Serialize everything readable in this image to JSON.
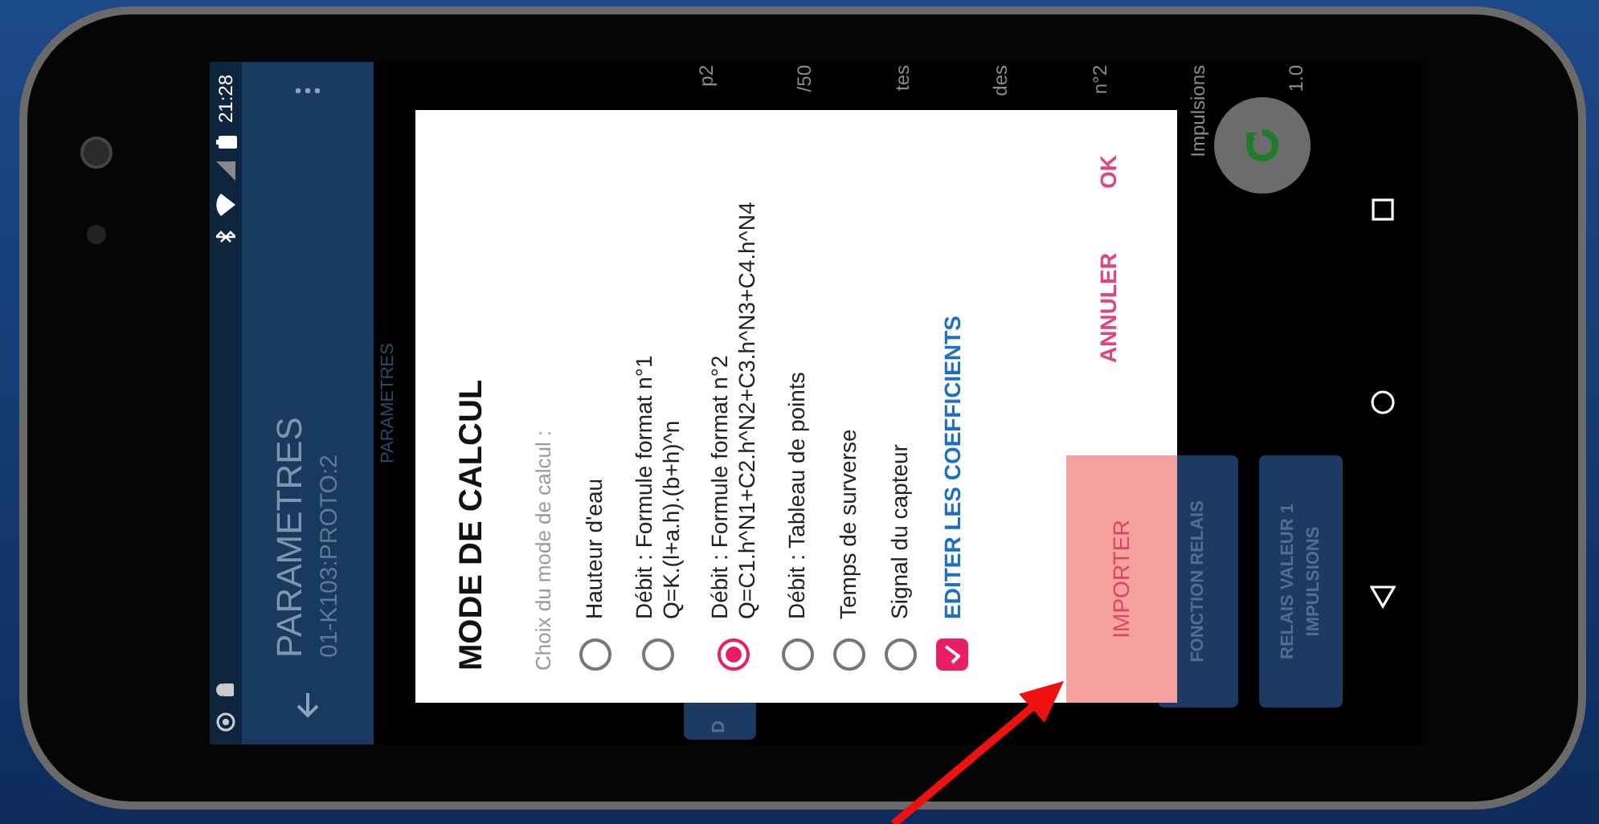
{
  "status_bar": {
    "time": "21:28"
  },
  "app_bar": {
    "title": "PARAMETRES",
    "subtitle": "01-K103:PROTO:2"
  },
  "section_label": "PARAMETRES",
  "background_labels": [
    "p2",
    "/50",
    "tes",
    "des",
    "n°2",
    "Impulsions",
    "1.0"
  ],
  "background_buttons": [
    "D",
    "FONCTION RELAIS",
    "RELAIS VALEUR 1 IMPULSIONS"
  ],
  "dialog": {
    "title": "MODE DE CALCUL",
    "subtitle": "Choix du mode de calcul :",
    "options": [
      {
        "label": "Hauteur d'eau",
        "selected": false
      },
      {
        "label": "Débit : Formule format n°1",
        "formula": "Q=K.(l+a.h).(b+h)^n",
        "selected": false
      },
      {
        "label": "Débit : Formule format n°2",
        "formula": "Q=C1.h^N1+C2.h^N2+C3.h^N3+C4.h^N4",
        "selected": true
      },
      {
        "label": "Débit : Tableau de points",
        "selected": false
      },
      {
        "label": "Temps de surverse",
        "selected": false
      },
      {
        "label": "Signal du capteur",
        "selected": false
      }
    ],
    "checkbox": {
      "label": "EDITER LES COEFFICIENTS",
      "checked": true
    },
    "actions": [
      "ANNULER",
      "OK"
    ]
  },
  "import_button": "IMPORTER"
}
